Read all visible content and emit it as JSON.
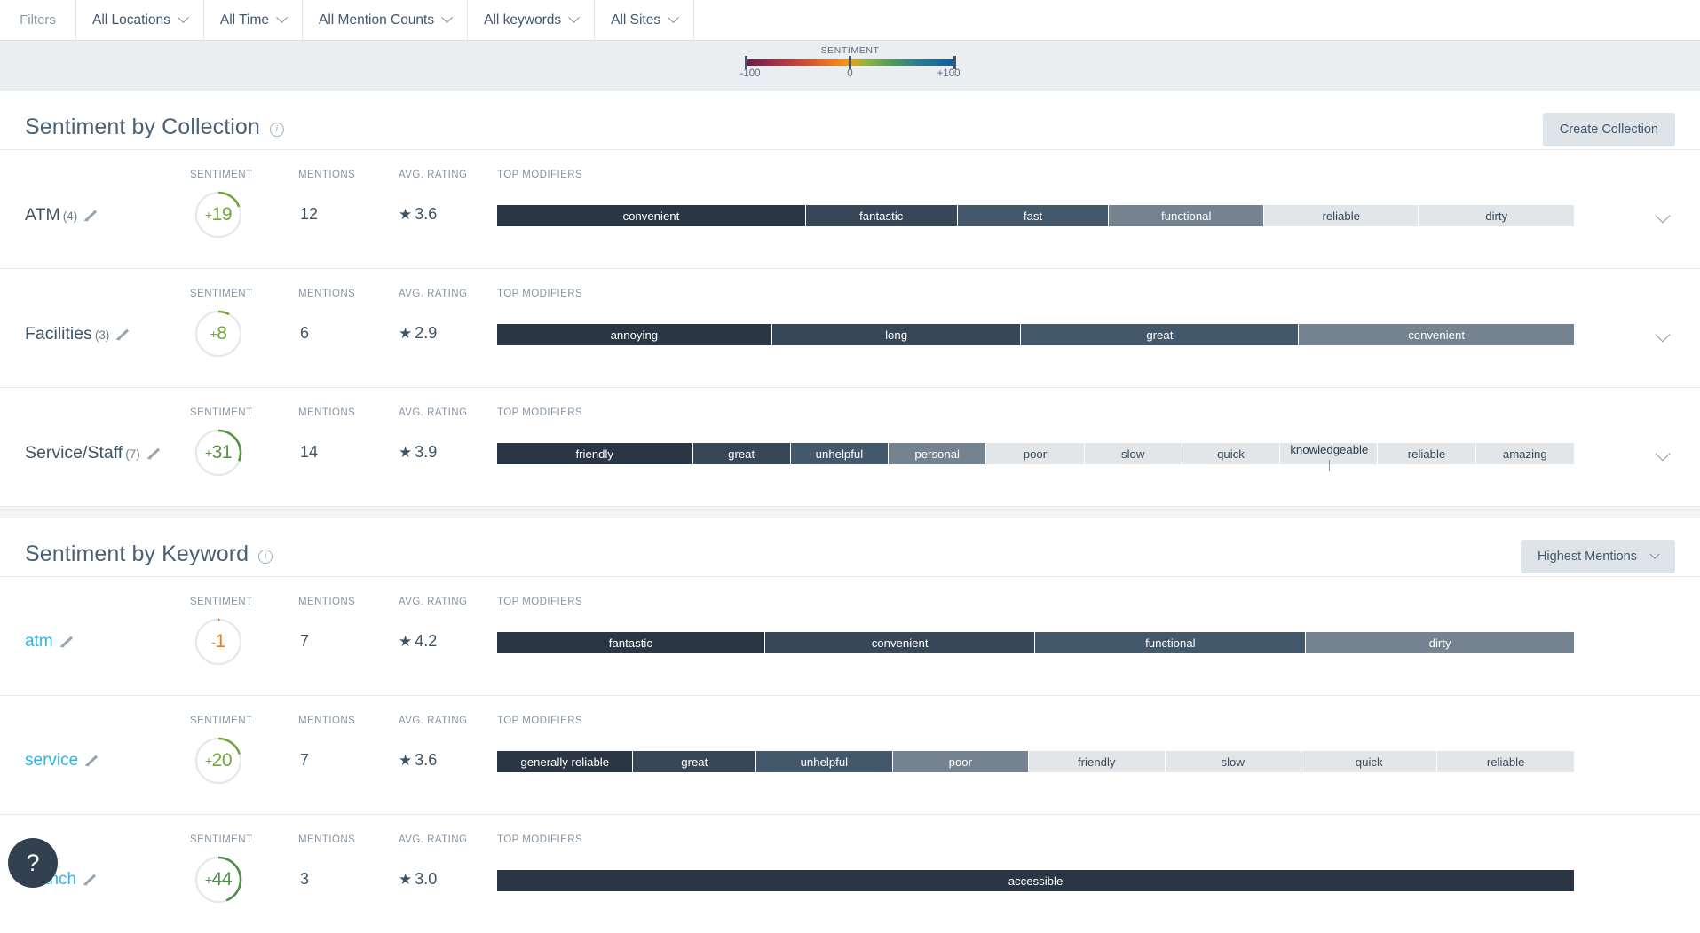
{
  "filters": {
    "label": "Filters",
    "items": [
      {
        "label": "All Locations",
        "icon": "chevron-down-icon"
      },
      {
        "label": "All Time",
        "icon": "chevron-down-icon"
      },
      {
        "label": "All Mention Counts",
        "icon": "chevron-down-icon"
      },
      {
        "label": "All keywords",
        "icon": "chevron-down-icon"
      },
      {
        "label": "All Sites",
        "icon": "chevron-down-icon"
      }
    ]
  },
  "legend": {
    "title": "SENTIMENT",
    "min": "-100",
    "mid": "0",
    "max": "+100"
  },
  "columns": {
    "sentiment": "SENTIMENT",
    "mentions": "MENTIONS",
    "rating": "AVG. RATING",
    "modifiers": "TOP MODIFIERS"
  },
  "collections": {
    "title": "Sentiment by Collection",
    "info_icon": "info-icon",
    "create_button": "Create Collection",
    "rows": [
      {
        "name": "ATM",
        "count": "(4)",
        "sentiment": "+19",
        "sentiment_sign": "+",
        "sentiment_value": 19,
        "sentiment_color": "#72a53a",
        "mentions": "12",
        "rating": "3.6",
        "modifiers": [
          {
            "label": "convenient",
            "weight": 285,
            "shade": 0
          },
          {
            "label": "fantastic",
            "weight": 140,
            "shade": 1
          },
          {
            "label": "fast",
            "weight": 140,
            "shade": 2
          },
          {
            "label": "functional",
            "weight": 143,
            "shade": 3
          },
          {
            "label": "reliable",
            "weight": 143,
            "shade": 4
          },
          {
            "label": "dirty",
            "weight": 143,
            "shade": 5
          }
        ]
      },
      {
        "name": "Facilities",
        "count": "(3)",
        "sentiment": "+8",
        "sentiment_sign": "+",
        "sentiment_value": 8,
        "sentiment_color": "#72a53a",
        "mentions": "6",
        "rating": "2.9",
        "modifiers": [
          {
            "label": "annoying",
            "weight": 300,
            "shade": 0
          },
          {
            "label": "long",
            "weight": 272,
            "shade": 1
          },
          {
            "label": "great",
            "weight": 303,
            "shade": 2
          },
          {
            "label": "convenient",
            "weight": 300,
            "shade": 3
          }
        ]
      },
      {
        "name": "Service/Staff",
        "count": "(7)",
        "sentiment": "+31",
        "sentiment_sign": "+",
        "sentiment_value": 31,
        "sentiment_color": "#5a9442",
        "mentions": "14",
        "rating": "3.9",
        "modifiers": [
          {
            "label": "friendly",
            "weight": 220,
            "shade": 0
          },
          {
            "label": "great",
            "weight": 110,
            "shade": 1
          },
          {
            "label": "unhelpful",
            "weight": 110,
            "shade": 2
          },
          {
            "label": "personal",
            "weight": 110,
            "shade": 3
          },
          {
            "label": "poor",
            "weight": 110,
            "shade": 4
          },
          {
            "label": "slow",
            "weight": 110,
            "shade": 5
          },
          {
            "label": "quick",
            "weight": 110,
            "shade": 5
          },
          {
            "label": "knowledgeable",
            "weight": 110,
            "shade": 5,
            "callout": true
          },
          {
            "label": "reliable",
            "weight": 110,
            "shade": 5
          },
          {
            "label": "amazing",
            "weight": 110,
            "shade": 5
          }
        ]
      }
    ]
  },
  "keywords": {
    "title": "Sentiment by Keyword",
    "info_icon": "info-icon",
    "sort_label": "Highest Mentions",
    "rows": [
      {
        "name": "atm",
        "count": "",
        "sentiment": "-1",
        "sentiment_sign": "-",
        "sentiment_value": -1,
        "sentiment_color": "#f07c1e",
        "mentions": "7",
        "rating": "4.2",
        "modifiers": [
          {
            "label": "fantastic",
            "weight": 300,
            "shade": 0
          },
          {
            "label": "convenient",
            "weight": 303,
            "shade": 1
          },
          {
            "label": "functional",
            "weight": 303,
            "shade": 2
          },
          {
            "label": "dirty",
            "weight": 300,
            "shade": 3
          }
        ]
      },
      {
        "name": "service",
        "count": "",
        "sentiment": "+20",
        "sentiment_sign": "+",
        "sentiment_value": 20,
        "sentiment_color": "#72a53a",
        "mentions": "7",
        "rating": "3.6",
        "modifiers": [
          {
            "label": "generally reliable",
            "weight": 155,
            "shade": 0
          },
          {
            "label": "great",
            "weight": 140,
            "shade": 1
          },
          {
            "label": "unhelpful",
            "weight": 155,
            "shade": 2
          },
          {
            "label": "poor",
            "weight": 155,
            "shade": 3
          },
          {
            "label": "friendly",
            "weight": 155,
            "shade": 4
          },
          {
            "label": "slow",
            "weight": 155,
            "shade": 5
          },
          {
            "label": "quick",
            "weight": 155,
            "shade": 5
          },
          {
            "label": "reliable",
            "weight": 155,
            "shade": 5
          }
        ]
      },
      {
        "name": "branch",
        "count": "",
        "sentiment": "+44",
        "sentiment_sign": "+",
        "sentiment_value": 44,
        "sentiment_color": "#4f8e46",
        "mentions": "3",
        "rating": "3.0",
        "modifiers": [
          {
            "label": "accessible",
            "weight": 1210,
            "shade": 0
          }
        ]
      }
    ]
  },
  "help": {
    "label": "?",
    "icon": "question-mark-icon"
  }
}
